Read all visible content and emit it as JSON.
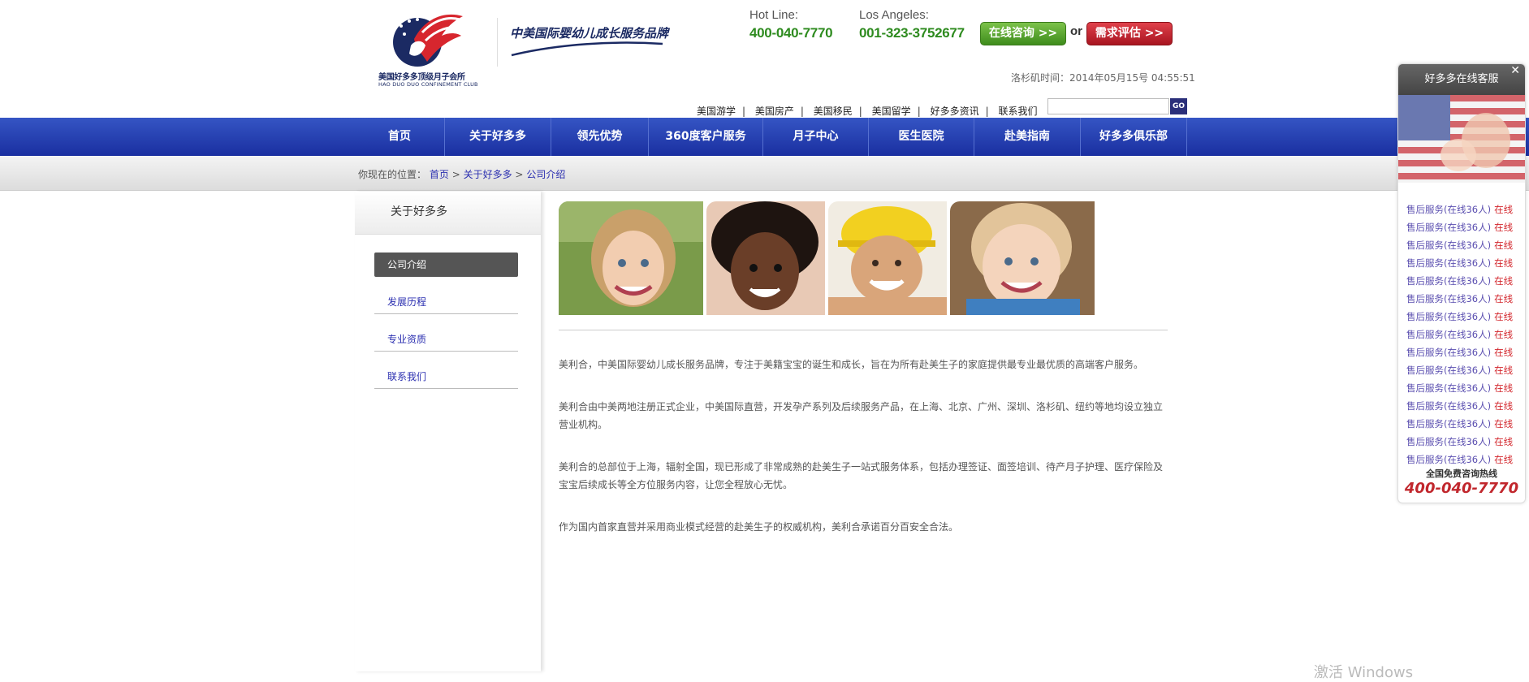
{
  "brand": {
    "logo_cn": "美国好多多顶级月子会所",
    "logo_en": "HAO DUO DUO CONFINEMENT CLUB",
    "slogan": "中美国际婴幼儿成长服务品牌"
  },
  "contact": {
    "hotline_label": "Hot Line:",
    "hotline_number": "400-040-7770",
    "la_label": "Los Angeles:",
    "la_number": "001-323-3752677",
    "consult_button": "在线咨询 >>",
    "or_text": "or",
    "evaluate_button": "需求评估 >>"
  },
  "la_time": "洛杉矶时间：2014年05月15号 04:55:51",
  "top_links": [
    "美国游学",
    "美国房产",
    "美国移民",
    "美国留学",
    "好多多资讯",
    "联系我们"
  ],
  "search": {
    "placeholder": "",
    "go_label": "GO"
  },
  "nav": {
    "items": [
      "首页",
      "关于好多多",
      "领先优势",
      "360度客户服务",
      "月子中心",
      "医生医院",
      "赴美指南",
      "好多多俱乐部"
    ]
  },
  "breadcrumb": {
    "prefix": "你现在的位置：",
    "items": [
      "首页",
      "关于好多多",
      "公司介绍"
    ],
    "sep": ">"
  },
  "sidebar": {
    "title": "关于好多多",
    "items": [
      "公司介绍",
      "发展历程",
      "专业资质",
      "联系我们"
    ],
    "active_index": 0
  },
  "content": {
    "paragraphs": [
      "美利合，中美国际婴幼儿成长服务品牌，专注于美籍宝宝的诞生和成长，旨在为所有赴美生子的家庭提供最专业最优质的高端客户服务。",
      "美利合由中美两地注册正式企业，中美国际直营，开发孕产系列及后续服务产品，在上海、北京、广州、深圳、洛杉矶、纽约等地均设立独立营业机构。",
      "美利合的总部位于上海，辐射全国，现已形成了非常成熟的赴美生子一站式服务体系，包括办理签证、面签培训、待产月子护理、医疗保险及宝宝后续成长等全方位服务内容，让您全程放心无忧。",
      "作为国内首家直营并采用商业模式经营的赴美生子的权威机构，美利合承诺百分百安全合法。"
    ]
  },
  "widget": {
    "title": "好多多在线客服",
    "close": "✕",
    "rows": [
      {
        "svc": "售后服务(在线36人)",
        "status": "在线"
      },
      {
        "svc": "售后服务(在线36人)",
        "status": "在线"
      },
      {
        "svc": "售后服务(在线36人)",
        "status": "在线"
      },
      {
        "svc": "售后服务(在线36人)",
        "status": "在线"
      },
      {
        "svc": "售后服务(在线36人)",
        "status": "在线"
      },
      {
        "svc": "售后服务(在线36人)",
        "status": "在线"
      },
      {
        "svc": "售后服务(在线36人)",
        "status": "在线"
      },
      {
        "svc": "售后服务(在线36人)",
        "status": "在线"
      },
      {
        "svc": "售后服务(在线36人)",
        "status": "在线"
      },
      {
        "svc": "售后服务(在线36人)",
        "status": "在线"
      },
      {
        "svc": "售后服务(在线36人)",
        "status": "在线"
      },
      {
        "svc": "售后服务(在线36人)",
        "status": "在线"
      },
      {
        "svc": "售后服务(在线36人)",
        "status": "在线"
      },
      {
        "svc": "售后服务(在线36人)",
        "status": "在线"
      },
      {
        "svc": "售后服务(在线36人)",
        "status": "在线"
      }
    ],
    "hotline_label": "全国免费咨询热线",
    "hotline_number": "400-040-7770"
  },
  "watermark": "激活 Windows",
  "colors": {
    "nav": "#2440b3",
    "link": "#2b2fb0",
    "green": "#2e8b1f",
    "red": "#c1272d"
  }
}
